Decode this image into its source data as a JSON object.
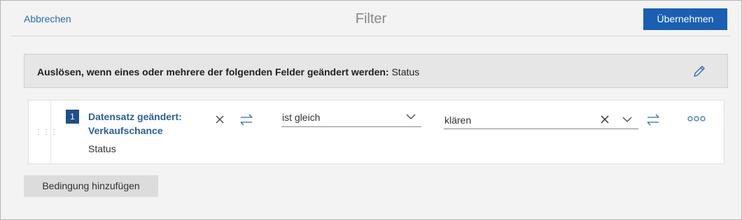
{
  "header": {
    "cancel_label": "Abbrechen",
    "title": "Filter",
    "apply_label": "Übernehmen"
  },
  "trigger": {
    "label": "Auslösen, wenn eines oder mehrere der folgenden Felder geändert werden:",
    "value": "Status",
    "edit_icon": "pencil-icon"
  },
  "condition": {
    "step_number": "1",
    "field_title": "Datensatz geändert: Verkaufschance",
    "field_sub": "Status",
    "operator": "ist gleich",
    "value": "klären",
    "icons": [
      "close-icon",
      "swap-icon",
      "chevron-down-icon",
      "more-icon"
    ]
  },
  "actions": {
    "add_condition_label": "Bedingung hinzufügen"
  },
  "colors": {
    "accent": "#1a5fb4",
    "link": "#2b6cb0",
    "background": "#f3f3f3"
  }
}
